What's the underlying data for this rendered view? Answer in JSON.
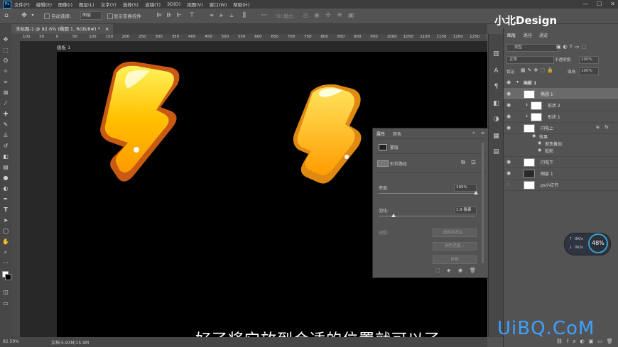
{
  "menubar": {
    "items": [
      "文件(F)",
      "编辑(E)",
      "图像(I)",
      "图层(L)",
      "文字(Y)",
      "选择(S)",
      "滤镜(T)",
      "3D(D)",
      "视图(V)",
      "窗口(W)",
      "帮助(H)"
    ]
  },
  "options": {
    "auto_select_label": "自动选择:",
    "auto_select_value": "图层",
    "show_transform_label": "显示变换控件",
    "mode3d_label": "3D 模式:"
  },
  "document": {
    "tab_title": "未标题-1 @ 82.6% (椭圆 1, RGB/8#) *",
    "artboard_name": "画板 1"
  },
  "ruler": {
    "ticks": [
      "100",
      "50",
      "0",
      "50",
      "100",
      "150",
      "200",
      "250",
      "300",
      "350",
      "400",
      "450",
      "500",
      "550",
      "600",
      "650",
      "700",
      "750",
      "800",
      "850",
      "900",
      "950",
      "1000",
      "1050",
      "1100",
      "1150",
      "1200",
      "1250",
      "1300"
    ]
  },
  "subtitle": "好了将它放到合适的位置就可以了",
  "status": {
    "zoom": "82.59%",
    "doc_size": "文档:5.93M/15.9M"
  },
  "properties": {
    "tab_properties": "属性",
    "tab_color": "颜色",
    "mask_label": "蒙版",
    "path_label": "形状路径",
    "density_label": "密度:",
    "density_value": "100%",
    "feather_label": "羽化:",
    "feather_value": "1.9 像素",
    "refine_label": "调整:",
    "select_subject": "选择并遮住...",
    "color_range": "颜色范围...",
    "invert": "反相"
  },
  "layers": {
    "tab_layers": "图层",
    "tab_paths": "路径",
    "tab_channels": "通道",
    "kind_label": "类型",
    "blend_mode": "正常",
    "opacity_label": "不透明度:",
    "opacity_value": "100%",
    "lock_label": "锁定:",
    "fill_label": "填充:",
    "fill_value": "100%",
    "rows": [
      {
        "name": "画板 1"
      },
      {
        "name": "椭圆 1"
      },
      {
        "name": "形状 2"
      },
      {
        "name": "形状 1"
      },
      {
        "name": "闪电上"
      },
      {
        "name": "效果"
      },
      {
        "name": "渐变叠加"
      },
      {
        "name": "投影"
      },
      {
        "name": "闪电下"
      },
      {
        "name": "图层 1"
      },
      {
        "name": "ps小红书"
      }
    ]
  },
  "watermarks": {
    "top": "小北Design",
    "bottom": "UiBQ.CoM"
  },
  "speed": {
    "up": "0K/s",
    "down": "0K/s",
    "percent": "48%"
  },
  "colors": {
    "bolt_main": "#f7b500",
    "bolt_outline": "#d2691e",
    "accent": "#31a8ff"
  }
}
